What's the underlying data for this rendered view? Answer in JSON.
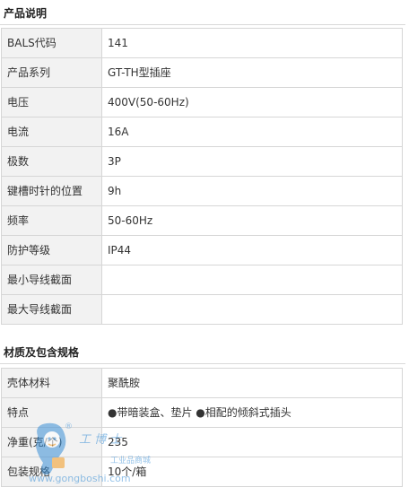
{
  "product_section": {
    "title": "产品说明",
    "rows": [
      {
        "label": "BALS代码",
        "value": "141"
      },
      {
        "label": "产品系列",
        "value": "GT-TH型插座"
      },
      {
        "label": "电压",
        "value": "400V(50-60Hz)"
      },
      {
        "label": "电流",
        "value": "16A"
      },
      {
        "label": "极数",
        "value": "3P"
      },
      {
        "label": "键槽时针的位置",
        "value": "9h"
      },
      {
        "label": "频率",
        "value": "50-60Hz"
      },
      {
        "label": "防护等级",
        "value": "IP44"
      },
      {
        "label": "最小导线截面",
        "value": ""
      },
      {
        "label": "最大导线截面",
        "value": ""
      }
    ]
  },
  "material_section": {
    "title": "材质及包含规格",
    "rows": [
      {
        "label": "壳体材料",
        "value": "聚酰胺"
      },
      {
        "label": "特点",
        "value": "●带暗装盒、垫片 ●相配的倾斜式插头"
      },
      {
        "label": "净重(克/个)",
        "value": "235"
      },
      {
        "label": "包装规格",
        "value": "10个/箱"
      }
    ]
  },
  "watermark": {
    "brand_text": "工 博 士",
    "sub_text": "工业品商城",
    "url_text": "www.gongboshi.com",
    "registered_mark": "®",
    "colors": {
      "blue": "#3a8fd6",
      "orange": "#f39a1e"
    }
  }
}
